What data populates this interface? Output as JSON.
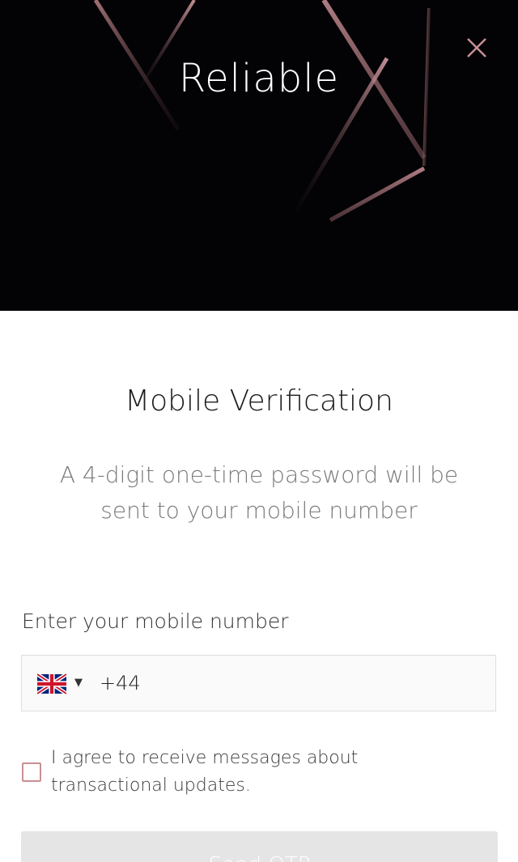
{
  "header": {
    "brand": "Reliable",
    "close_icon": "close-icon"
  },
  "verification": {
    "title": "Mobile Verification",
    "subtitle": "A 4-digit one-time password will be sent to your mobile number"
  },
  "phone": {
    "label": "Enter your mobile number",
    "country_flag": "uk-flag-icon",
    "dial_code": "+44",
    "value": ""
  },
  "consent": {
    "text": "I agree to receive messages about transactional updates.",
    "checked": false
  },
  "send_button": {
    "label": "Send OTP",
    "enabled": false
  },
  "colors": {
    "hero_background": "#030205",
    "accent_rose": "#c98f94",
    "button_disabled": "#e5e5e5"
  }
}
